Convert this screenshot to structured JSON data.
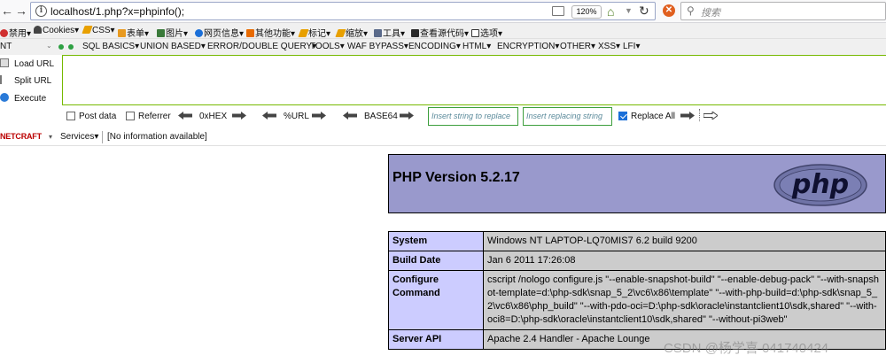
{
  "navbar": {
    "back_glyph": "←",
    "forward_glyph": "→",
    "url": "localhost/1.php?x=phpinfo();",
    "zoom": "120%",
    "search_placeholder": "搜索"
  },
  "devtoolbar": {
    "items": [
      "禁用▾",
      "Cookies▾",
      "CSS▾",
      "表单▾",
      "图片▾",
      "网页信息▾",
      "其他功能▾",
      "标记▾",
      "缩放▾",
      "工具▾",
      "查看源代码▾",
      "选项▾"
    ]
  },
  "hackbar": {
    "select_value": "NT",
    "menu": [
      "SQL BASICS▾",
      "UNION BASED▾",
      "ERROR/DOUBLE QUERY▾",
      "TOOLS▾",
      "WAF BYPASS▾",
      "ENCODING▾",
      "HTML▾",
      "ENCRYPTION▾",
      "OTHER▾",
      "XSS▾",
      "LFI▾"
    ],
    "load_url": "Load URL",
    "split_url": "Split URL",
    "execute": "Execute",
    "post_data": "Post data",
    "referrer": "Referrer",
    "hex": "0xHEX",
    "url_enc": "%URL",
    "base64": "BASE64",
    "insert_placeholder": "Insert string to replace",
    "replacing_placeholder": "Insert replacing string",
    "replace_all": "Replace All",
    "post_checked": false,
    "referrer_checked": false,
    "replace_all_checked": true
  },
  "netcraft": {
    "logo": "NETCRAFT",
    "services": "Services▾",
    "info": "[No information available]"
  },
  "phpinfo": {
    "title": "PHP Version 5.2.17",
    "logo_text": "php",
    "rows": [
      {
        "label": "System",
        "value": "Windows NT LAPTOP-LQ70MIS7 6.2 build 9200"
      },
      {
        "label": "Build Date",
        "value": "Jan 6 2011 17:26:08"
      },
      {
        "label": "Configure\nCommand",
        "value": "cscript /nologo configure.js \"--enable-snapshot-build\" \"--enable-debug-pack\" \"--with-snapshot-template=d:\\php-sdk\\snap_5_2\\vc6\\x86\\template\" \"--with-php-build=d:\\php-sdk\\snap_5_2\\vc6\\x86\\php_build\" \"--with-pdo-oci=D:\\php-sdk\\oracle\\instantclient10\\sdk,shared\" \"--with-oci8=D:\\php-sdk\\oracle\\instantclient10\\sdk,shared\" \"--without-pi3web\""
      },
      {
        "label": "Server API",
        "value": "Apache 2.4 Handler - Apache Lounge"
      }
    ]
  },
  "watermark": "CSDN @杨学喜 041740424"
}
